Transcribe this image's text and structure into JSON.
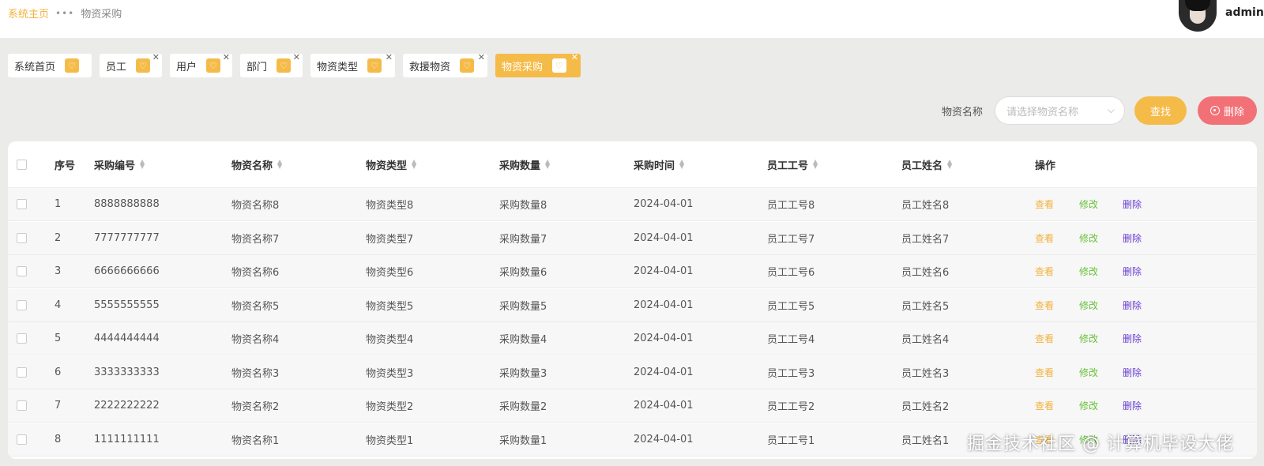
{
  "breadcrumb": {
    "home": "系统主页",
    "separator": "•••",
    "current": "物资采购"
  },
  "user": {
    "name": "admin"
  },
  "tabs": [
    {
      "label": "系统首页",
      "closable": false,
      "active": false
    },
    {
      "label": "员工",
      "closable": true,
      "active": false
    },
    {
      "label": "用户",
      "closable": true,
      "active": false
    },
    {
      "label": "部门",
      "closable": true,
      "active": false
    },
    {
      "label": "物资类型",
      "closable": true,
      "active": false
    },
    {
      "label": "救援物资",
      "closable": true,
      "active": false
    },
    {
      "label": "物资采购",
      "closable": true,
      "active": true
    }
  ],
  "search": {
    "label": "物资名称",
    "placeholder": "请选择物资名称",
    "search_button": "查找",
    "delete_button": "删除"
  },
  "table": {
    "headers": {
      "index": "序号",
      "code": "采购编号",
      "name": "物资名称",
      "type": "物资类型",
      "qty": "采购数量",
      "time": "采购时间",
      "emp_no": "员工工号",
      "emp_name": "员工姓名",
      "ops": "操作"
    },
    "actions": {
      "view": "查看",
      "edit": "修改",
      "delete": "删除"
    },
    "rows": [
      {
        "index": "1",
        "code": "8888888888",
        "name": "物资名称8",
        "type": "物资类型8",
        "qty": "采购数量8",
        "time": "2024-04-01",
        "emp_no": "员工工号8",
        "emp_name": "员工姓名8"
      },
      {
        "index": "2",
        "code": "7777777777",
        "name": "物资名称7",
        "type": "物资类型7",
        "qty": "采购数量7",
        "time": "2024-04-01",
        "emp_no": "员工工号7",
        "emp_name": "员工姓名7"
      },
      {
        "index": "3",
        "code": "6666666666",
        "name": "物资名称6",
        "type": "物资类型6",
        "qty": "采购数量6",
        "time": "2024-04-01",
        "emp_no": "员工工号6",
        "emp_name": "员工姓名6"
      },
      {
        "index": "4",
        "code": "5555555555",
        "name": "物资名称5",
        "type": "物资类型5",
        "qty": "采购数量5",
        "time": "2024-04-01",
        "emp_no": "员工工号5",
        "emp_name": "员工姓名5"
      },
      {
        "index": "5",
        "code": "4444444444",
        "name": "物资名称4",
        "type": "物资类型4",
        "qty": "采购数量4",
        "time": "2024-04-01",
        "emp_no": "员工工号4",
        "emp_name": "员工姓名4"
      },
      {
        "index": "6",
        "code": "3333333333",
        "name": "物资名称3",
        "type": "物资类型3",
        "qty": "采购数量3",
        "time": "2024-04-01",
        "emp_no": "员工工号3",
        "emp_name": "员工姓名3"
      },
      {
        "index": "7",
        "code": "2222222222",
        "name": "物资名称2",
        "type": "物资类型2",
        "qty": "采购数量2",
        "time": "2024-04-01",
        "emp_no": "员工工号2",
        "emp_name": "员工姓名2"
      },
      {
        "index": "8",
        "code": "1111111111",
        "name": "物资名称1",
        "type": "物资类型1",
        "qty": "采购数量1",
        "time": "2024-04-01",
        "emp_no": "员工工号1",
        "emp_name": "员工姓名1"
      }
    ]
  },
  "watermark": "掘金技术社区 @ 计算机毕设大佬",
  "colors": {
    "accent": "#f5bb49",
    "danger": "#f27177",
    "edit": "#67c23a",
    "delete_link": "#6a3fd0"
  }
}
